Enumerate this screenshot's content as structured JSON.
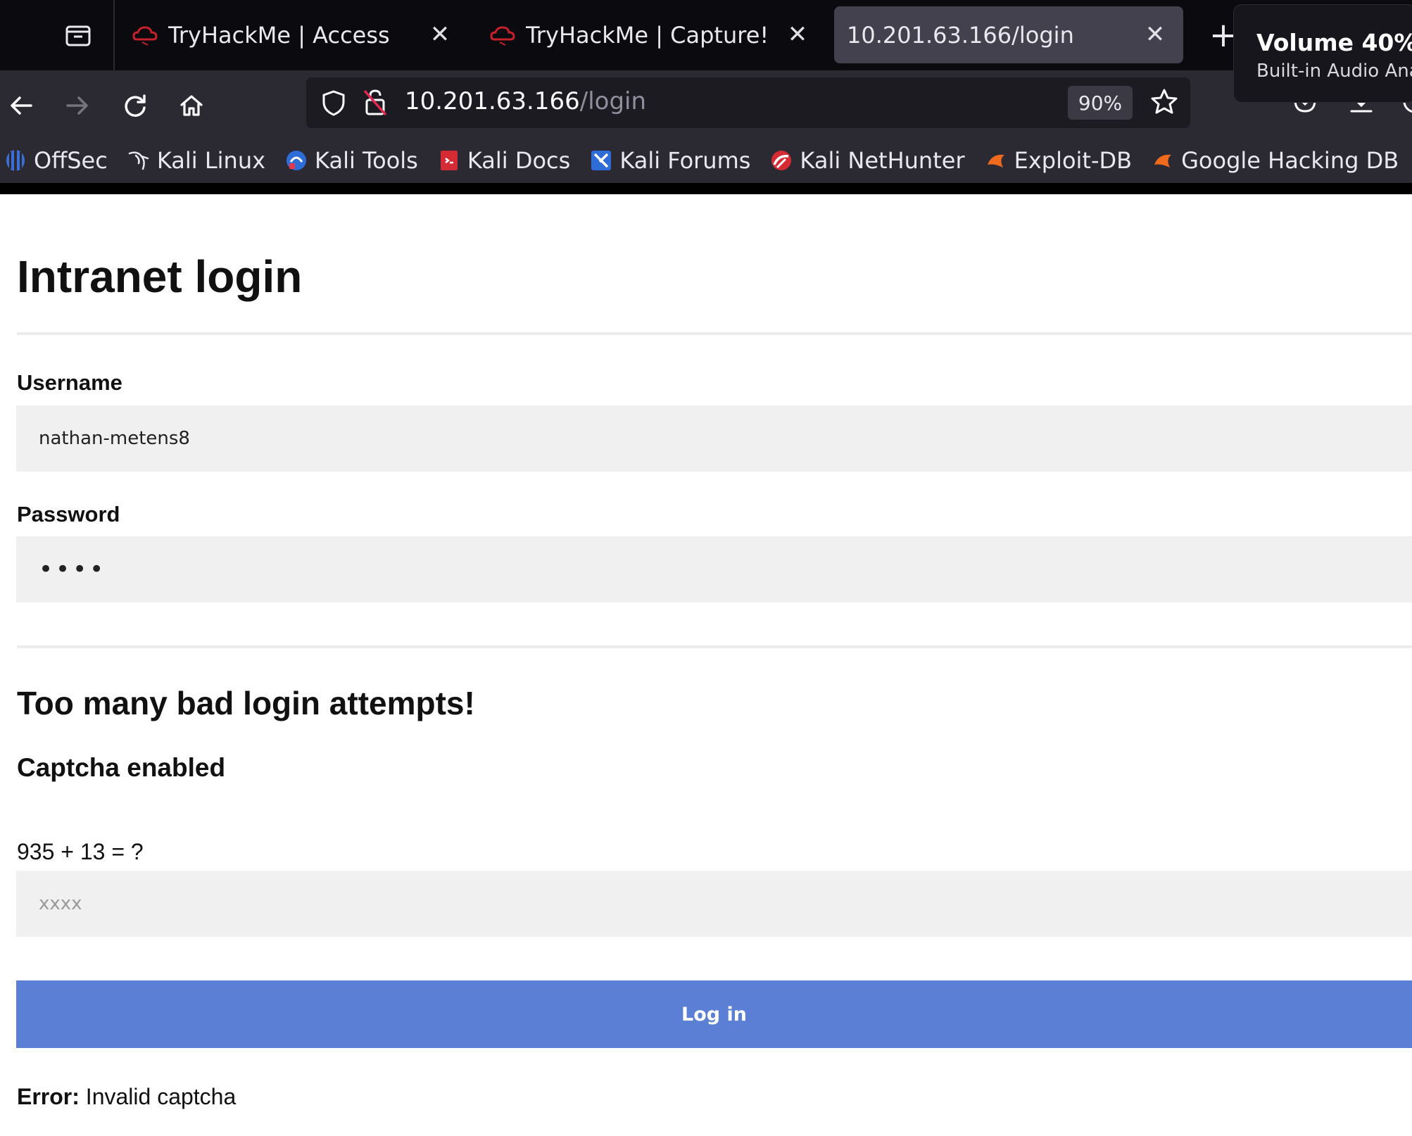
{
  "browser": {
    "tabs": [
      {
        "label": "TryHackMe | Access",
        "active": false
      },
      {
        "label": "TryHackMe | Capture!",
        "active": false
      },
      {
        "label": "10.201.63.166/login",
        "active": true
      }
    ],
    "url_host": "10.201.63.166",
    "url_path": "/login",
    "zoom": "90%",
    "bookmarks": [
      {
        "label": "OffSec",
        "icon": "offsec-icon"
      },
      {
        "label": "Kali Linux",
        "icon": "kali-dragon-icon"
      },
      {
        "label": "Kali Tools",
        "icon": "kali-tools-icon"
      },
      {
        "label": "Kali Docs",
        "icon": "kali-docs-icon"
      },
      {
        "label": "Kali Forums",
        "icon": "kali-forums-icon"
      },
      {
        "label": "Kali NetHunter",
        "icon": "kali-nethunter-icon"
      },
      {
        "label": "Exploit-DB",
        "icon": "exploit-db-icon"
      },
      {
        "label": "Google Hacking DB",
        "icon": "ghdb-icon"
      }
    ]
  },
  "volume_popup": {
    "title": "Volume 40%",
    "subtitle": "Built-in Audio Ana"
  },
  "page": {
    "title": "Intranet login",
    "username_label": "Username",
    "username_value": "nathan-metens8",
    "password_label": "Password",
    "password_value": "abcd",
    "warning_heading": "Too many bad login attempts!",
    "captcha_heading": "Captcha enabled",
    "captcha_question": "935 + 13 = ?",
    "captcha_placeholder": "xxxx",
    "login_button": "Log in",
    "error_label": "Error:",
    "error_message": "Invalid captcha"
  },
  "colors": {
    "button_bg": "#5a7fd4",
    "input_bg": "#f0f0f0",
    "chrome_dark": "#2b2a33"
  }
}
